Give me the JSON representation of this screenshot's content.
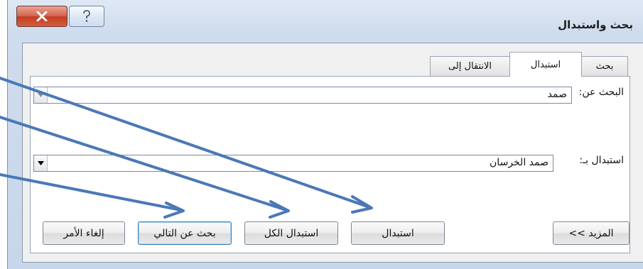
{
  "window": {
    "title": "بحث واستبدال"
  },
  "tabs": [
    {
      "label": "بحث"
    },
    {
      "label": "استبدال"
    },
    {
      "label": "الانتقال إلى"
    }
  ],
  "find": {
    "label": "البحث عن:",
    "value": "صمد"
  },
  "replace": {
    "label": "استبدال بـ:",
    "value": "صمد الخرسان"
  },
  "buttons": {
    "more": "المزيد >>",
    "replace": "استبدال",
    "replace_all": "استبدال الكل",
    "find_next": "بحث عن التالي",
    "cancel": "إلغاء الأمر"
  },
  "colors": {
    "annotation_arrow": "#4a78b6",
    "close_button": "#c8442c"
  },
  "icons": {
    "close": "close-icon",
    "help": "help-icon",
    "dropdown": "chevron-down-icon"
  }
}
